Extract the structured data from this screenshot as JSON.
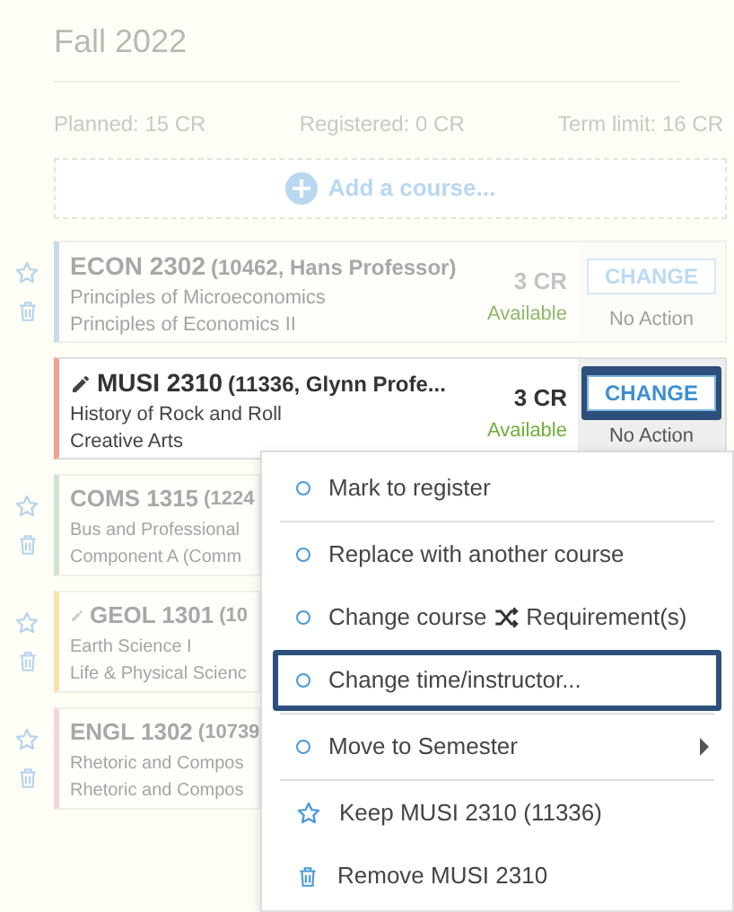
{
  "term": {
    "title": "Fall 2022",
    "stats": [
      "Planned: 15 CR",
      "Registered: 0 CR",
      "Term limit: 16 CR"
    ],
    "add_course": "Add a course..."
  },
  "courses": [
    {
      "code": "ECON 2302",
      "detail": "(10462, Hans Professor)",
      "title": "Principles of Microeconomics",
      "category": "Principles of Economics II",
      "credits": "3 CR",
      "status": "Available",
      "button": "CHANGE",
      "action": "No Action",
      "faded": true,
      "edited": false,
      "highlighted": false,
      "color": "#c9d9ee"
    },
    {
      "code": "MUSI 2310",
      "detail": "(11336, Glynn Profe...",
      "title": "History of Rock and Roll",
      "category": "Creative Arts",
      "credits": "3 CR",
      "status": "Available",
      "button": "CHANGE",
      "action": "No Action",
      "faded": false,
      "edited": true,
      "highlighted": true,
      "color": "#f4a090"
    },
    {
      "code": "COMS 1315",
      "detail": "(1224",
      "title": "Bus and Professional",
      "category": "Component A (Comm",
      "faded": true,
      "edited": false,
      "color": "#cfe3d4"
    },
    {
      "code": "GEOL 1301",
      "detail": "(10",
      "title": "Earth Science I",
      "category": "Life & Physical Scienc",
      "faded": true,
      "edited": true,
      "color": "#f6e4a8"
    },
    {
      "code": "ENGL 1302",
      "detail": "(10739",
      "title": "Rhetoric and Compos",
      "category": "Rhetoric and Compos",
      "faded": true,
      "edited": false,
      "color": "#f3d6da"
    }
  ],
  "menu": [
    {
      "kind": "option",
      "label": "Mark to register",
      "divider_after": true,
      "highlighted": false
    },
    {
      "kind": "option",
      "label": "Replace with another course",
      "divider_after": false,
      "highlighted": false
    },
    {
      "kind": "option",
      "label": "Change course",
      "label_after": "Requirement(s)",
      "divider_after": false,
      "highlighted": false
    },
    {
      "kind": "option",
      "label": "Change time/instructor...",
      "divider_after": true,
      "highlighted": true
    },
    {
      "kind": "submenu",
      "label": "Move to Semester",
      "divider_after": true,
      "highlighted": false
    },
    {
      "kind": "keep",
      "label": "Keep MUSI 2310 (11336)",
      "divider_after": false,
      "highlighted": false
    },
    {
      "kind": "remove",
      "label": "Remove MUSI 2310",
      "divider_after": false,
      "highlighted": false
    }
  ]
}
